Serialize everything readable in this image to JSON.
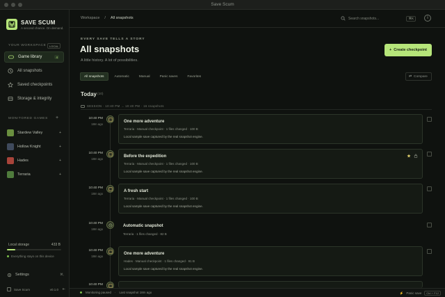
{
  "window": {
    "title": "Save Scum"
  },
  "brand": {
    "name": "SAVE SCUM",
    "tagline": "A second chance. On demand."
  },
  "workspace": {
    "label": "YOUR WORKSPACE",
    "badge": "LOCAL"
  },
  "nav": [
    {
      "label": "Game library",
      "icon": "gamepad-icon",
      "count": "4",
      "active": true
    },
    {
      "label": "All snapshots",
      "icon": "history-icon",
      "active": false
    },
    {
      "label": "Saved checkpoints",
      "icon": "star-icon",
      "active": false
    },
    {
      "label": "Storage & integrity",
      "icon": "storage-icon",
      "active": false
    }
  ],
  "monitored": {
    "label": "MONITORED GAMES",
    "add": "+",
    "games": [
      {
        "name": "Stardew Valley",
        "mark": "+",
        "color": "#6a8f3f"
      },
      {
        "name": "Hollow Knight",
        "mark": "+",
        "color": "#3f4a5c"
      },
      {
        "name": "Hades",
        "mark": "+",
        "color": "#a8443a"
      },
      {
        "name": "Terraria",
        "mark": "+",
        "color": "#4f7b3c"
      }
    ]
  },
  "storage": {
    "label": "Local storage",
    "value": "433 B",
    "fill": 0.15,
    "note": "Everything stays on this device"
  },
  "settings": {
    "label": "Settings",
    "shortcut": "⌘,"
  },
  "footer": {
    "app": "Save Scum",
    "version": "v0.1.0",
    "toggle": "⇤"
  },
  "breadcrumb": {
    "root": "Workspace",
    "sep": "/",
    "current": "All snapshots"
  },
  "search": {
    "placeholder": "Search snapshots...",
    "shortcut": "⌘K"
  },
  "info": "i",
  "header": {
    "eyebrow": "EVERY SAVE TELLS A STORY",
    "title": "All snapshots",
    "subtitle": "A little history. A lot of possibilities.",
    "create_label": "Create checkpoint",
    "create_icon": "+"
  },
  "filters": [
    "All snapshots",
    "Automatic",
    "Manual",
    "Panic saves",
    "Favorites"
  ],
  "compare_label": "Compare",
  "day": {
    "title": "Today",
    "count": "(10)"
  },
  "session": {
    "text": "SESSION · 10:40 PM → 10:40 PM · 16 snapshots"
  },
  "timeline": [
    {
      "time": "10:40 PM",
      "ago": "18m ago",
      "title": "One more adventure",
      "meta": "Terraria · Manual checkpoint · 1 files changed · 100 B",
      "desc": "Local sample save captured by the real snapshot engine.",
      "type": "card",
      "starred": false
    },
    {
      "time": "10:40 PM",
      "ago": "18m ago",
      "title": "Before the expedition",
      "meta": "Terraria · Manual checkpoint · 1 files changed · 100 B",
      "desc": "Local sample save captured by the real snapshot engine.",
      "type": "card",
      "starred": true
    },
    {
      "time": "10:40 PM",
      "ago": "18m ago",
      "title": "A fresh start",
      "meta": "Terraria · Manual checkpoint · 1 files changed · 100 B",
      "desc": "Local sample save captured by the real snapshot engine.",
      "type": "card",
      "starred": false
    },
    {
      "time": "10:40 PM",
      "ago": "18m ago",
      "title": "Automatic snapshot",
      "meta": "Terraria · 1 files changed · 82 B",
      "desc": "",
      "type": "plain",
      "starred": false
    },
    {
      "time": "10:40 PM",
      "ago": "18m ago",
      "title": "One more adventure",
      "meta": "Hades · Manual checkpoint · 1 files changed · 91 B",
      "desc": "Local sample save captured by the real snapshot engine.",
      "type": "card",
      "starred": false
    },
    {
      "time": "10:40 PM",
      "ago": "",
      "title": "",
      "meta": "",
      "desc": "",
      "type": "partial",
      "starred": false
    }
  ],
  "status": {
    "monitoring": "Monitoring paused",
    "last": "Last snapshot 18m ago",
    "panic": "Panic save",
    "panic_keys": "Ctrl + F12"
  }
}
